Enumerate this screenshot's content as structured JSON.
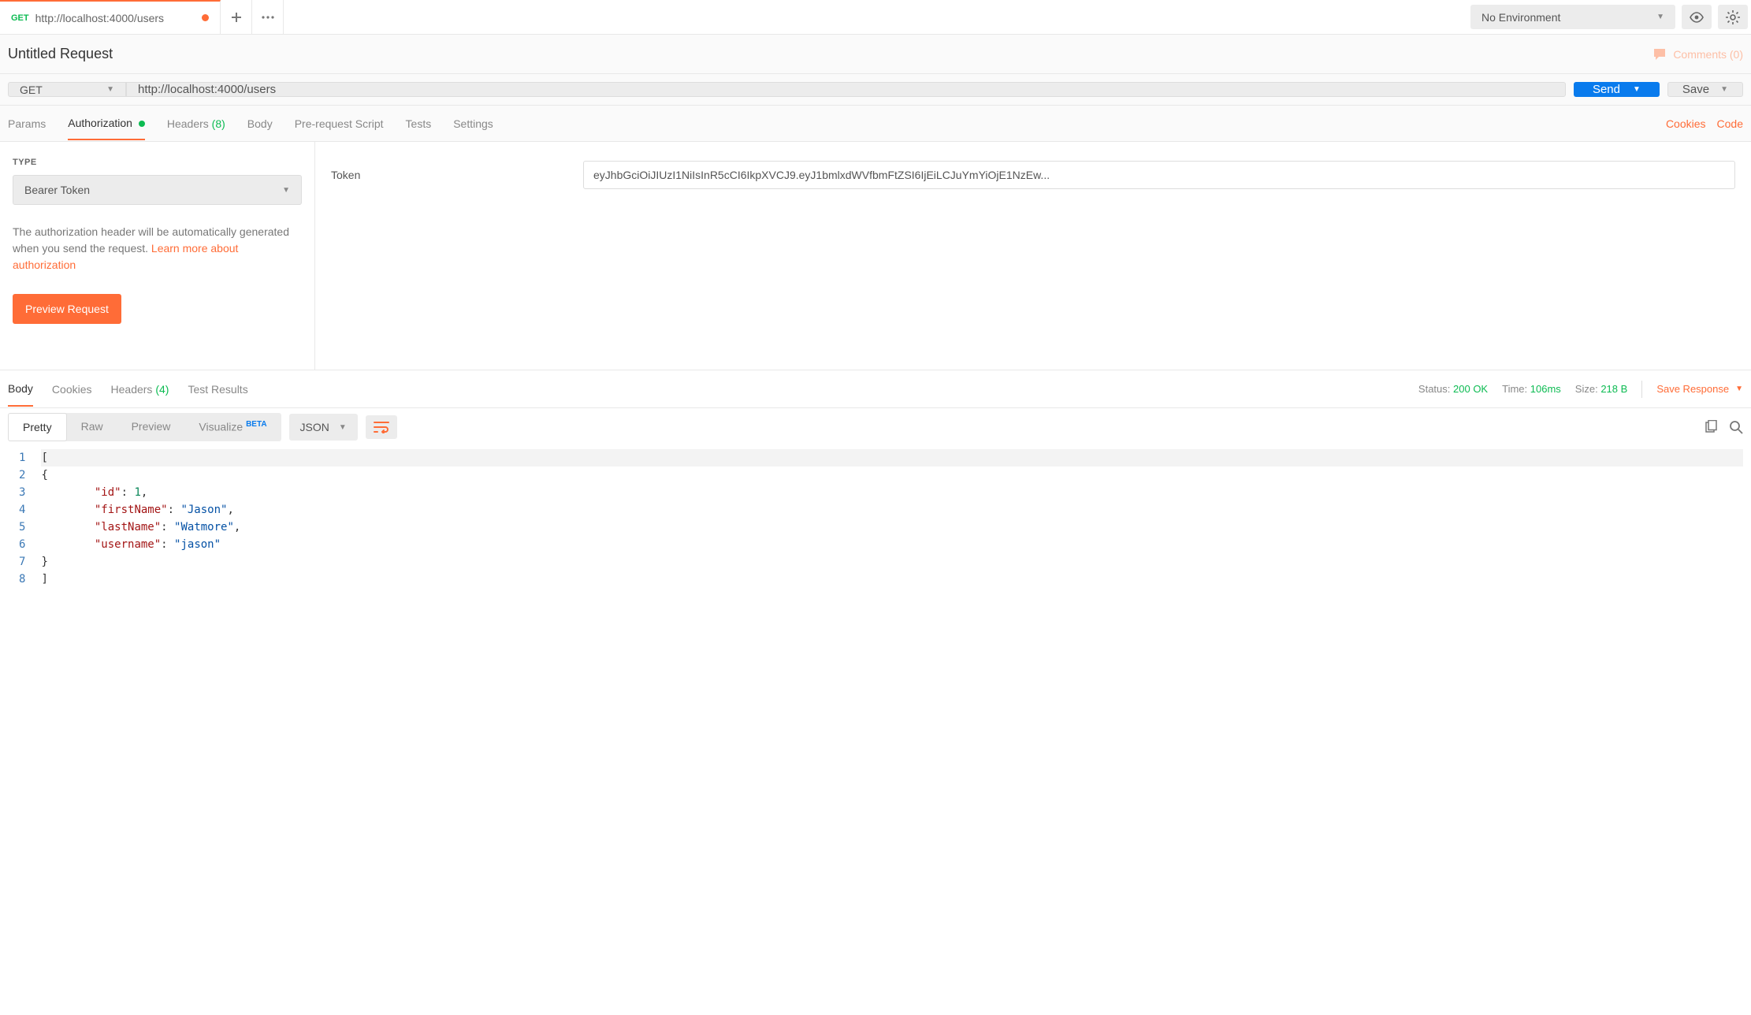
{
  "tab": {
    "method": "GET",
    "title": "http://localhost:4000/users"
  },
  "env": {
    "selected": "No Environment"
  },
  "request_title": "Untitled Request",
  "comments": {
    "label": "Comments (0)"
  },
  "url_row": {
    "method": "GET",
    "url": "http://localhost:4000/users",
    "send": "Send",
    "save": "Save"
  },
  "req_tabs": {
    "params": "Params",
    "auth": "Authorization",
    "headers": "Headers",
    "headers_count": "(8)",
    "body": "Body",
    "prerequest": "Pre-request Script",
    "tests": "Tests",
    "settings": "Settings",
    "cookies": "Cookies",
    "code": "Code"
  },
  "auth": {
    "type_label": "TYPE",
    "type_value": "Bearer Token",
    "description_1": "The authorization header will be automatically generated when you send the request. ",
    "learn_more": "Learn more about authorization",
    "preview": "Preview Request",
    "token_label": "Token",
    "token_value": "eyJhbGciOiJIUzI1NiIsInR5cCI6IkpXVCJ9.eyJ1bmlxdWVfbmFtZSI6IjEiLCJuYmYiOjE1NzEw..."
  },
  "resp_tabs": {
    "body": "Body",
    "cookies": "Cookies",
    "headers": "Headers",
    "headers_count": "(4)",
    "tests": "Test Results"
  },
  "resp_meta": {
    "status_label": "Status:",
    "status_value": "200 OK",
    "time_label": "Time:",
    "time_value": "106ms",
    "size_label": "Size:",
    "size_value": "218 B",
    "save_response": "Save Response"
  },
  "view_tabs": {
    "pretty": "Pretty",
    "raw": "Raw",
    "preview": "Preview",
    "visualize": "Visualize",
    "beta": "BETA",
    "format": "JSON"
  },
  "code": {
    "lines": [
      "1",
      "2",
      "3",
      "4",
      "5",
      "6",
      "7",
      "8"
    ],
    "l1": "[",
    "l2": "    {",
    "l3_key": "\"id\"",
    "l3_colon": ": ",
    "l3_val": "1",
    "l3_comma": ",",
    "l4_key": "\"firstName\"",
    "l4_colon": ": ",
    "l4_val": "\"Jason\"",
    "l4_comma": ",",
    "l5_key": "\"lastName\"",
    "l5_colon": ": ",
    "l5_val": "\"Watmore\"",
    "l5_comma": ",",
    "l6_key": "\"username\"",
    "l6_colon": ": ",
    "l6_val": "\"jason\"",
    "l7": "    }",
    "l8": "]"
  }
}
